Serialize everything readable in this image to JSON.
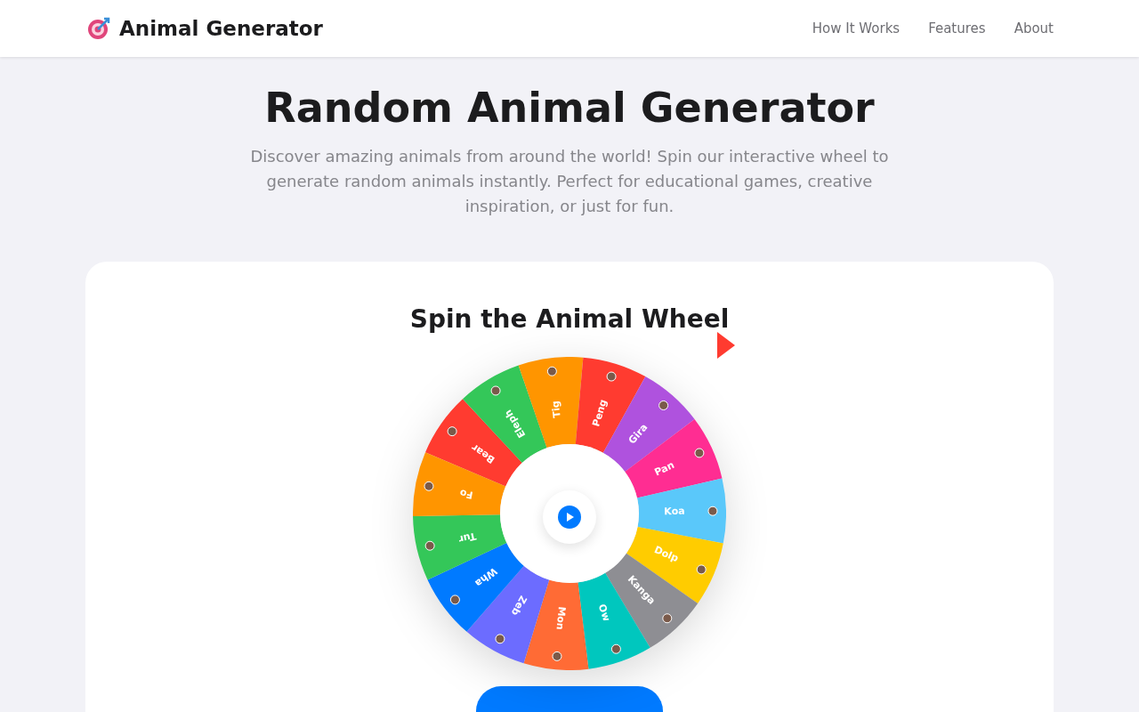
{
  "header": {
    "brand": "Animal Generator",
    "nav": [
      "How It Works",
      "Features",
      "About"
    ]
  },
  "hero": {
    "title": "Random Animal Generator",
    "subtitle": "Discover amazing animals from around the world! Spin our interactive wheel to generate random animals instantly. Perfect for educational games, creative inspiration, or just for fun."
  },
  "card": {
    "title": "Spin the Animal Wheel",
    "segments": [
      {
        "label": "Bear",
        "color": "#ff3b30"
      },
      {
        "label": "Eleph",
        "color": "#34c759"
      },
      {
        "label": "Tig",
        "color": "#ff9500"
      },
      {
        "label": "Peng",
        "color": "#ff3b30"
      },
      {
        "label": "Gira",
        "color": "#af52de"
      },
      {
        "label": "Pan",
        "color": "#ff2d92"
      },
      {
        "label": "Koa",
        "color": "#5ac8fa"
      },
      {
        "label": "Dolp",
        "color": "#ffcc00"
      },
      {
        "label": "Kanga",
        "color": "#8e8e93"
      },
      {
        "label": "Ow",
        "color": "#00c7be"
      },
      {
        "label": "Mon",
        "color": "#ff6b35"
      },
      {
        "label": "Zeb",
        "color": "#6c6cff"
      },
      {
        "label": "Wha",
        "color": "#007aff"
      },
      {
        "label": "Tur",
        "color": "#34c759"
      },
      {
        "label": "Fo",
        "color": "#ff9500"
      }
    ]
  }
}
